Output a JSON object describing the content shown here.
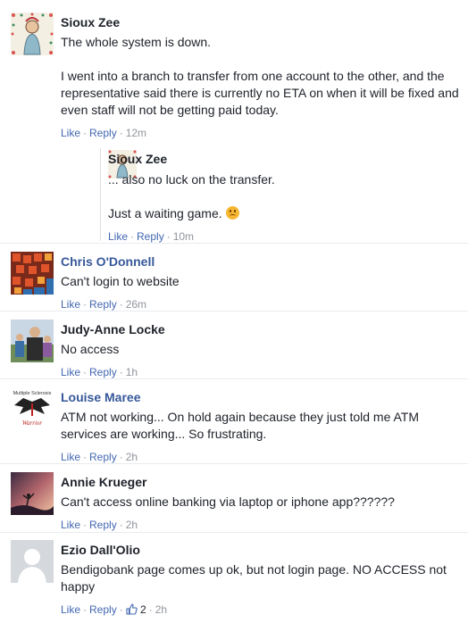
{
  "comments": [
    {
      "name": "Sioux Zee",
      "paragraphs": [
        "The whole system is down.",
        "I went into a branch to transfer from one account to the other, and the representative said there is currently no ETA on when it will be fixed and even staff will not be getting paid today."
      ],
      "like": "Like",
      "reply": "Reply",
      "time": "12m"
    },
    {
      "name": "Sioux Zee",
      "paragraphs": [
        "... also no luck on the transfer.",
        "Just a waiting game."
      ],
      "like": "Like",
      "reply": "Reply",
      "time": "10m"
    },
    {
      "name": "Chris O'Donnell",
      "text": "Can't login to website",
      "like": "Like",
      "reply": "Reply",
      "time": "26m"
    },
    {
      "name": "Judy-Anne Locke",
      "text": "No access",
      "like": "Like",
      "reply": "Reply",
      "time": "1h"
    },
    {
      "name": "Louise Maree",
      "text": "ATM not working... On hold again because they just told me ATM services are working... So frustrating.",
      "like": "Like",
      "reply": "Reply",
      "time": "2h",
      "avatar_caption_top": "Multiple Sclerosis",
      "avatar_caption_bottom": "Warrior"
    },
    {
      "name": "Annie Krueger",
      "text": "Can't access online banking via laptop or iphone app??????",
      "like": "Like",
      "reply": "Reply",
      "time": "2h"
    },
    {
      "name": "Ezio Dall'Olio",
      "text": "Bendigobank page comes up ok, but not login page. NO ACCESS not happy",
      "like": "Like",
      "reply": "Reply",
      "likes_count": "2",
      "time": "2h"
    }
  ],
  "separator": "·",
  "colors": {
    "link": "#4267b2",
    "name_link": "#365899",
    "meta": "#90949c",
    "text": "#1d2129"
  },
  "icons": {
    "emoji": "frowning-emoji-icon",
    "like": "thumbs-up-icon"
  }
}
